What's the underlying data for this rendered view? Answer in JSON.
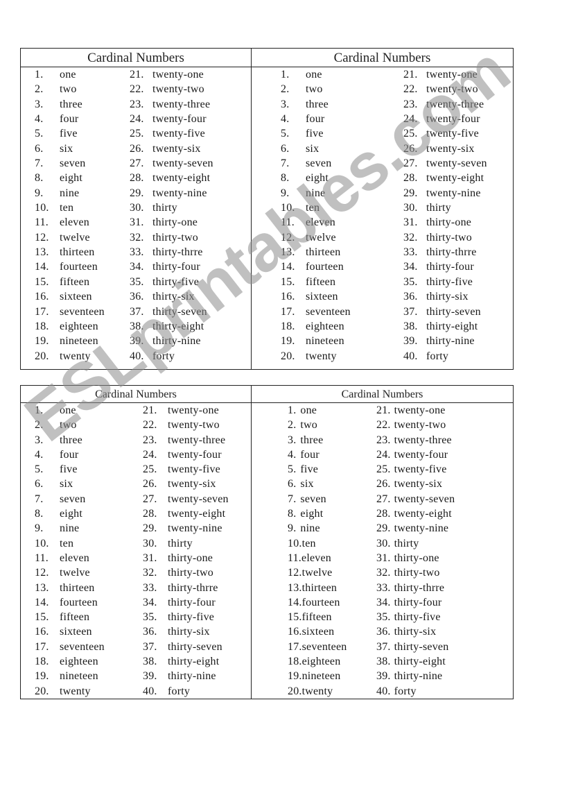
{
  "watermark": "ESLprintables.com",
  "tables": {
    "top": {
      "left": {
        "title": "Cardinal Numbers",
        "col1": [
          {
            "num": "1.",
            "word": "one"
          },
          {
            "num": "2.",
            "word": "two"
          },
          {
            "num": "3.",
            "word": "three"
          },
          {
            "num": "4.",
            "word": "four"
          },
          {
            "num": "5.",
            "word": "five"
          },
          {
            "num": "6.",
            "word": "six"
          },
          {
            "num": "7.",
            "word": "seven"
          },
          {
            "num": "8.",
            "word": "eight"
          },
          {
            "num": "9.",
            "word": "nine"
          },
          {
            "num": "10.",
            "word": "ten"
          },
          {
            "num": "11.",
            "word": "eleven"
          },
          {
            "num": "12.",
            "word": "twelve"
          },
          {
            "num": "13.",
            "word": "thirteen"
          },
          {
            "num": "14.",
            "word": "fourteen"
          },
          {
            "num": "15.",
            "word": "fifteen"
          },
          {
            "num": "16.",
            "word": "sixteen"
          },
          {
            "num": "17.",
            "word": "seventeen"
          },
          {
            "num": "18.",
            "word": "eighteen"
          },
          {
            "num": "19.",
            "word": "nineteen"
          },
          {
            "num": "20.",
            "word": "twenty"
          }
        ],
        "col2": [
          {
            "num": "21.",
            "word": "twenty-one"
          },
          {
            "num": "22.",
            "word": "twenty-two"
          },
          {
            "num": "23.",
            "word": "twenty-three"
          },
          {
            "num": "24.",
            "word": "twenty-four"
          },
          {
            "num": "25.",
            "word": "twenty-five"
          },
          {
            "num": "26.",
            "word": "twenty-six"
          },
          {
            "num": "27.",
            "word": "twenty-seven"
          },
          {
            "num": "28.",
            "word": "twenty-eight"
          },
          {
            "num": "29.",
            "word": "twenty-nine"
          },
          {
            "num": "30.",
            "word": "thirty"
          },
          {
            "num": "31.",
            "word": "thirty-one"
          },
          {
            "num": "32.",
            "word": "thirty-two"
          },
          {
            "num": "33.",
            "word": "thirty-thrre"
          },
          {
            "num": "34.",
            "word": "thirty-four"
          },
          {
            "num": "35.",
            "word": "thirty-five"
          },
          {
            "num": "36.",
            "word": "thirty-six"
          },
          {
            "num": "37.",
            "word": "thirty-seven"
          },
          {
            "num": "38.",
            "word": "thirty-eight"
          },
          {
            "num": "39.",
            "word": "thirty-nine"
          },
          {
            "num": "40.",
            "word": "forty"
          }
        ]
      },
      "right": {
        "title": "Cardinal Numbers",
        "col1": [
          {
            "num": "1.",
            "word": "one"
          },
          {
            "num": "2.",
            "word": "two"
          },
          {
            "num": "3.",
            "word": "three"
          },
          {
            "num": "4.",
            "word": "four"
          },
          {
            "num": "5.",
            "word": "five"
          },
          {
            "num": "6.",
            "word": "six"
          },
          {
            "num": "7.",
            "word": "seven"
          },
          {
            "num": "8.",
            "word": "eight"
          },
          {
            "num": "9.",
            "word": "nine"
          },
          {
            "num": "10.",
            "word": "ten"
          },
          {
            "num": "11.",
            "word": "eleven"
          },
          {
            "num": "12.",
            "word": "twelve"
          },
          {
            "num": "13.",
            "word": "thirteen"
          },
          {
            "num": "14.",
            "word": "fourteen"
          },
          {
            "num": "15.",
            "word": "fifteen"
          },
          {
            "num": "16.",
            "word": "sixteen"
          },
          {
            "num": "17.",
            "word": "seventeen"
          },
          {
            "num": "18.",
            "word": "eighteen"
          },
          {
            "num": "19.",
            "word": "nineteen"
          },
          {
            "num": "20.",
            "word": "twenty"
          }
        ],
        "col2": [
          {
            "num": "21.",
            "word": "twenty-one"
          },
          {
            "num": "22.",
            "word": "twenty-two"
          },
          {
            "num": "23.",
            "word": "twenty-three"
          },
          {
            "num": "24.",
            "word": "twenty-four"
          },
          {
            "num": "25.",
            "word": "twenty-five"
          },
          {
            "num": "26.",
            "word": "twenty-six"
          },
          {
            "num": "27.",
            "word": "twenty-seven"
          },
          {
            "num": "28.",
            "word": "twenty-eight"
          },
          {
            "num": "29.",
            "word": "twenty-nine"
          },
          {
            "num": "30.",
            "word": "thirty"
          },
          {
            "num": "31.",
            "word": "thirty-one"
          },
          {
            "num": "32.",
            "word": "thirty-two"
          },
          {
            "num": "33.",
            "word": "thirty-thrre"
          },
          {
            "num": "34.",
            "word": "thirty-four"
          },
          {
            "num": "35.",
            "word": "thirty-five"
          },
          {
            "num": "36.",
            "word": "thirty-six"
          },
          {
            "num": "37.",
            "word": "thirty-seven"
          },
          {
            "num": "38.",
            "word": "thirty-eight"
          },
          {
            "num": "39.",
            "word": "thirty-nine"
          },
          {
            "num": "40.",
            "word": "forty"
          }
        ]
      }
    },
    "bottom": {
      "left": {
        "title": "Cardinal Numbers",
        "col1": [
          {
            "num": "1.",
            "word": "one"
          },
          {
            "num": "2.",
            "word": "two"
          },
          {
            "num": "3.",
            "word": "three"
          },
          {
            "num": "4.",
            "word": "four"
          },
          {
            "num": "5.",
            "word": "five"
          },
          {
            "num": "6.",
            "word": "six"
          },
          {
            "num": "7.",
            "word": "seven"
          },
          {
            "num": "8.",
            "word": "eight"
          },
          {
            "num": "9.",
            "word": "nine"
          },
          {
            "num": "10.",
            "word": "ten"
          },
          {
            "num": "11.",
            "word": "eleven"
          },
          {
            "num": "12.",
            "word": "twelve"
          },
          {
            "num": "13.",
            "word": "thirteen"
          },
          {
            "num": "14.",
            "word": "fourteen"
          },
          {
            "num": "15.",
            "word": "fifteen"
          },
          {
            "num": "16.",
            "word": "sixteen"
          },
          {
            "num": "17.",
            "word": "seventeen"
          },
          {
            "num": "18.",
            "word": "eighteen"
          },
          {
            "num": "19.",
            "word": "nineteen"
          },
          {
            "num": "20.",
            "word": "twenty"
          }
        ],
        "col2": [
          {
            "num": "21.",
            "word": "twenty-one"
          },
          {
            "num": "22.",
            "word": "twenty-two"
          },
          {
            "num": "23.",
            "word": "twenty-three"
          },
          {
            "num": "24.",
            "word": "twenty-four"
          },
          {
            "num": "25.",
            "word": "twenty-five"
          },
          {
            "num": "26.",
            "word": "twenty-six"
          },
          {
            "num": "27.",
            "word": "twenty-seven"
          },
          {
            "num": "28.",
            "word": "twenty-eight"
          },
          {
            "num": "29.",
            "word": "twenty-nine"
          },
          {
            "num": "30.",
            "word": "thirty"
          },
          {
            "num": "31.",
            "word": "thirty-one"
          },
          {
            "num": "32.",
            "word": "thirty-two"
          },
          {
            "num": "33.",
            "word": "thirty-thrre"
          },
          {
            "num": "34.",
            "word": "thirty-four"
          },
          {
            "num": "35.",
            "word": "thirty-five"
          },
          {
            "num": "36.",
            "word": "thirty-six"
          },
          {
            "num": "37.",
            "word": "thirty-seven"
          },
          {
            "num": "38.",
            "word": "thirty-eight"
          },
          {
            "num": "39.",
            "word": "thirty-nine"
          },
          {
            "num": "40.",
            "word": "forty"
          }
        ]
      },
      "right": {
        "title": "Cardinal Numbers",
        "col1": [
          {
            "num": "1.",
            "word": "one"
          },
          {
            "num": "2.",
            "word": "two"
          },
          {
            "num": "3.",
            "word": "three"
          },
          {
            "num": "4.",
            "word": "four"
          },
          {
            "num": "5.",
            "word": "five"
          },
          {
            "num": "6.",
            "word": "six"
          },
          {
            "num": "7.",
            "word": "seven"
          },
          {
            "num": "8.",
            "word": "eight"
          },
          {
            "num": "9.",
            "word": "nine"
          },
          {
            "num": "10.",
            "word": "ten",
            "tight": true
          },
          {
            "num": "11.",
            "word": "eleven",
            "tight": true
          },
          {
            "num": "12.",
            "word": "twelve",
            "tight": true
          },
          {
            "num": "13.",
            "word": "thirteen",
            "tight": true
          },
          {
            "num": "14.",
            "word": "fourteen",
            "tight": true
          },
          {
            "num": "15.",
            "word": "fifteen",
            "tight": true
          },
          {
            "num": "16.",
            "word": "sixteen",
            "tight": true
          },
          {
            "num": "17.",
            "word": "seventeen",
            "tight": true
          },
          {
            "num": "18.",
            "word": "eighteen",
            "tight": true
          },
          {
            "num": "19.",
            "word": "nineteen",
            "tight": true
          },
          {
            "num": "20.",
            "word": "twenty",
            "tight": true
          }
        ],
        "col2": [
          {
            "num": "21.",
            "word": "twenty-one"
          },
          {
            "num": "22.",
            "word": "twenty-two"
          },
          {
            "num": "23.",
            "word": "twenty-three"
          },
          {
            "num": "24.",
            "word": "twenty-four"
          },
          {
            "num": "25.",
            "word": "twenty-five"
          },
          {
            "num": "26.",
            "word": "twenty-six"
          },
          {
            "num": "27.",
            "word": "twenty-seven"
          },
          {
            "num": "28.",
            "word": "twenty-eight"
          },
          {
            "num": "29.",
            "word": "twenty-nine"
          },
          {
            "num": "30.",
            "word": "thirty"
          },
          {
            "num": "31.",
            "word": "thirty-one"
          },
          {
            "num": "32.",
            "word": "thirty-two"
          },
          {
            "num": "33.",
            "word": "thirty-thrre"
          },
          {
            "num": "34.",
            "word": "thirty-four"
          },
          {
            "num": "35.",
            "word": "thirty-five"
          },
          {
            "num": "36.",
            "word": "thirty-six"
          },
          {
            "num": "37.",
            "word": "thirty-seven"
          },
          {
            "num": "38.",
            "word": "thirty-eight"
          },
          {
            "num": "39.",
            "word": "thirty-nine"
          },
          {
            "num": "40.",
            "word": "forty"
          }
        ]
      }
    }
  }
}
